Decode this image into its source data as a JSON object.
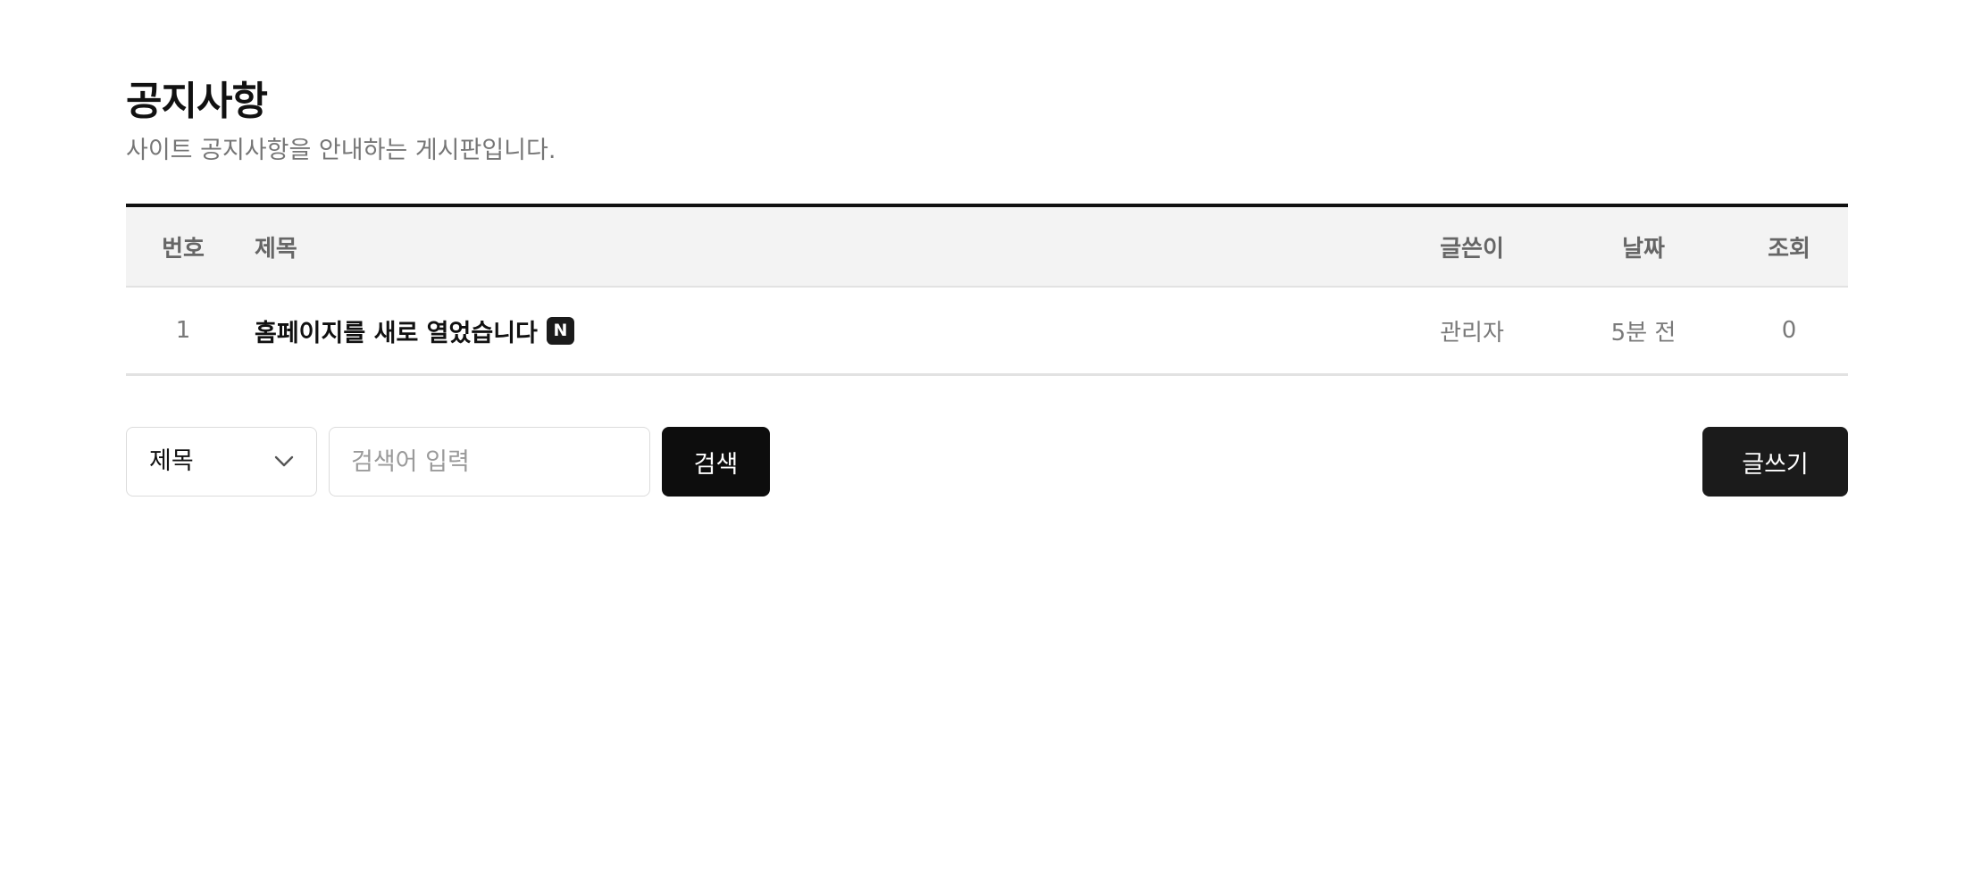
{
  "header": {
    "title": "공지사항",
    "subtitle": "사이트 공지사항을 안내하는 게시판입니다."
  },
  "table": {
    "columns": [
      "번호",
      "제목",
      "글쓴이",
      "날짜",
      "조회"
    ],
    "rows": [
      {
        "number": "1",
        "title": "홈페이지를 새로 열었습니다",
        "badge": "N",
        "writer": "관리자",
        "date": "5분 전",
        "views": "0"
      }
    ]
  },
  "search": {
    "field_selected": "제목",
    "placeholder": "검색어 입력",
    "button_label": "검색"
  },
  "actions": {
    "write_label": "글쓰기"
  },
  "icons": {
    "select_arrow": "chevron-down-icon"
  },
  "colors": {
    "text_primary": "#111111",
    "text_muted": "#767676",
    "header_bg": "#f3f3f3",
    "border": "#e2e2e2",
    "button_bg": "#0d0d0d",
    "badge_bg": "#1b1b1b"
  }
}
